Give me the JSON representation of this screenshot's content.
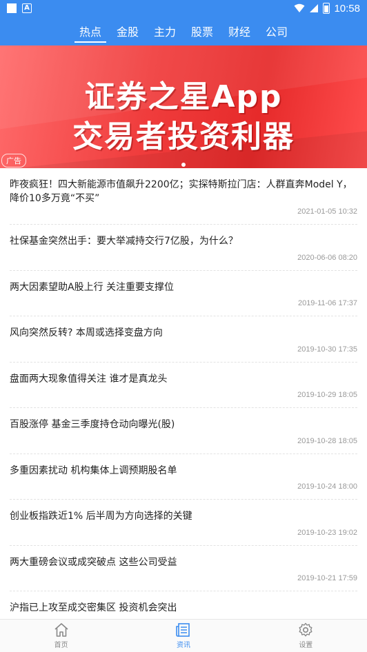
{
  "status_bar": {
    "time": "10:58"
  },
  "tabs": [
    {
      "label": "热点",
      "active": true
    },
    {
      "label": "金股",
      "active": false
    },
    {
      "label": "主力",
      "active": false
    },
    {
      "label": "股票",
      "active": false
    },
    {
      "label": "财经",
      "active": false
    },
    {
      "label": "公司",
      "active": false
    }
  ],
  "banner": {
    "line1": "证券之星App",
    "line2": "交易者投资利器",
    "ad_label": "广告"
  },
  "news": [
    {
      "title": "昨夜疯狂！四大新能源市值飙升2200亿；实探特斯拉门店：人群直奔Model Y，降价10多万竟“不买”",
      "date": "2021-01-05 10:32"
    },
    {
      "title": "社保基金突然出手：要大举减持交行7亿股，为什么？",
      "date": "2020-06-06 08:20"
    },
    {
      "title": "两大因素望助A股上行 关注重要支撑位",
      "date": "2019-11-06 17:37"
    },
    {
      "title": "风向突然反转? 本周或选择变盘方向",
      "date": "2019-10-30 17:35"
    },
    {
      "title": "盘面两大现象值得关注 谁才是真龙头",
      "date": "2019-10-29 18:05"
    },
    {
      "title": "百股涨停 基金三季度持仓动向曝光(股)",
      "date": "2019-10-28 18:05"
    },
    {
      "title": "多重因素扰动 机构集体上调预期股名单",
      "date": "2019-10-24 18:00"
    },
    {
      "title": "创业板指跌近1% 后半周为方向选择的关键",
      "date": "2019-10-23 19:02"
    },
    {
      "title": "两大重磅会议或成突破点 这些公司受益",
      "date": "2019-10-21 17:59"
    },
    {
      "title": "沪指已上攻至成交密集区 投资机会突出",
      "date": ""
    }
  ],
  "bottom_nav": [
    {
      "label": "首页",
      "icon": "home-icon",
      "active": false
    },
    {
      "label": "资讯",
      "icon": "news-icon",
      "active": true
    },
    {
      "label": "设置",
      "icon": "gear-icon",
      "active": false
    }
  ],
  "colors": {
    "primary": "#3b8cf0",
    "banner_red": "#f03d3d"
  }
}
